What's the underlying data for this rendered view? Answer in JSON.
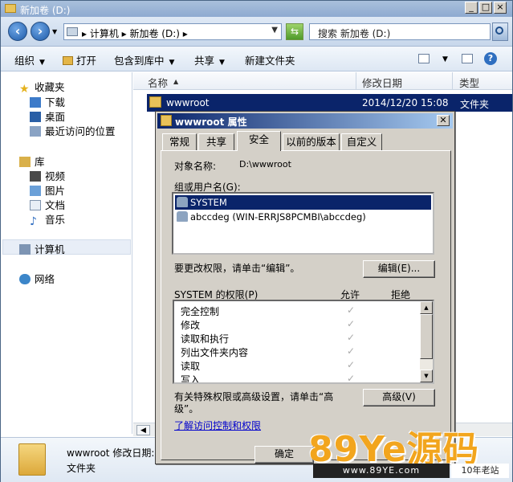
{
  "window": {
    "title": "新加卷 (D:)",
    "controls": [
      "_",
      "□",
      "×"
    ]
  },
  "address": {
    "path": "▸ 计算机 ▸ 新加卷 (D:) ▸",
    "search_placeholder": "搜索 新加卷 (D:)"
  },
  "toolbar": {
    "organize": "组织",
    "open": "打开",
    "include_in_library": "包含到库中",
    "share": "共享",
    "new_folder": "新建文件夹"
  },
  "nav": {
    "favorites": "收藏夹",
    "downloads": "下载",
    "desktop": "桌面",
    "recent": "最近访问的位置",
    "libraries": "库",
    "videos": "视频",
    "pictures": "图片",
    "documents": "文档",
    "music": "音乐",
    "computer": "计算机",
    "network": "网络"
  },
  "columns": {
    "name": "名称",
    "modified": "修改日期",
    "type": "类型"
  },
  "files": [
    {
      "name": "wwwroot",
      "modified": "2014/12/20 15:08",
      "type": "文件夹"
    }
  ],
  "details": {
    "name_line": "wwwroot 修改日期:",
    "type": "文件夹"
  },
  "dialog": {
    "title": "wwwroot 属性",
    "tabs": [
      "常规",
      "共享",
      "安全",
      "以前的版本",
      "自定义"
    ],
    "active_tab": "安全",
    "object_name_label": "对象名称:",
    "object_name_value": "D:\\wwwroot",
    "group_label": "组或用户名(G):",
    "users": [
      "SYSTEM",
      "abccdeg (WIN-ERRJS8PCMBI\\abccdeg)"
    ],
    "change_text": "要更改权限，请单击“编辑”。",
    "edit_button": "编辑(E)...",
    "perm_label": "SYSTEM 的权限(P)",
    "allow_label": "允许",
    "deny_label": "拒绝",
    "permissions": [
      "完全控制",
      "修改",
      "读取和执行",
      "列出文件夹内容",
      "读取",
      "写入"
    ],
    "advanced_text_1": "有关特殊权限或高级设置，请单击“高",
    "advanced_text_2": "级”。",
    "advanced_button": "高级(V)",
    "help_link": "了解访问控制和权限",
    "ok_button": "确定"
  },
  "watermark": {
    "brand": "89Ye源码",
    "url": "www.89YE.com",
    "tag": "10年老站"
  },
  "colors": {
    "selection": "#0a246a",
    "dialog_face": "#d4d0c8",
    "brand_orange": "#f2a51d"
  }
}
